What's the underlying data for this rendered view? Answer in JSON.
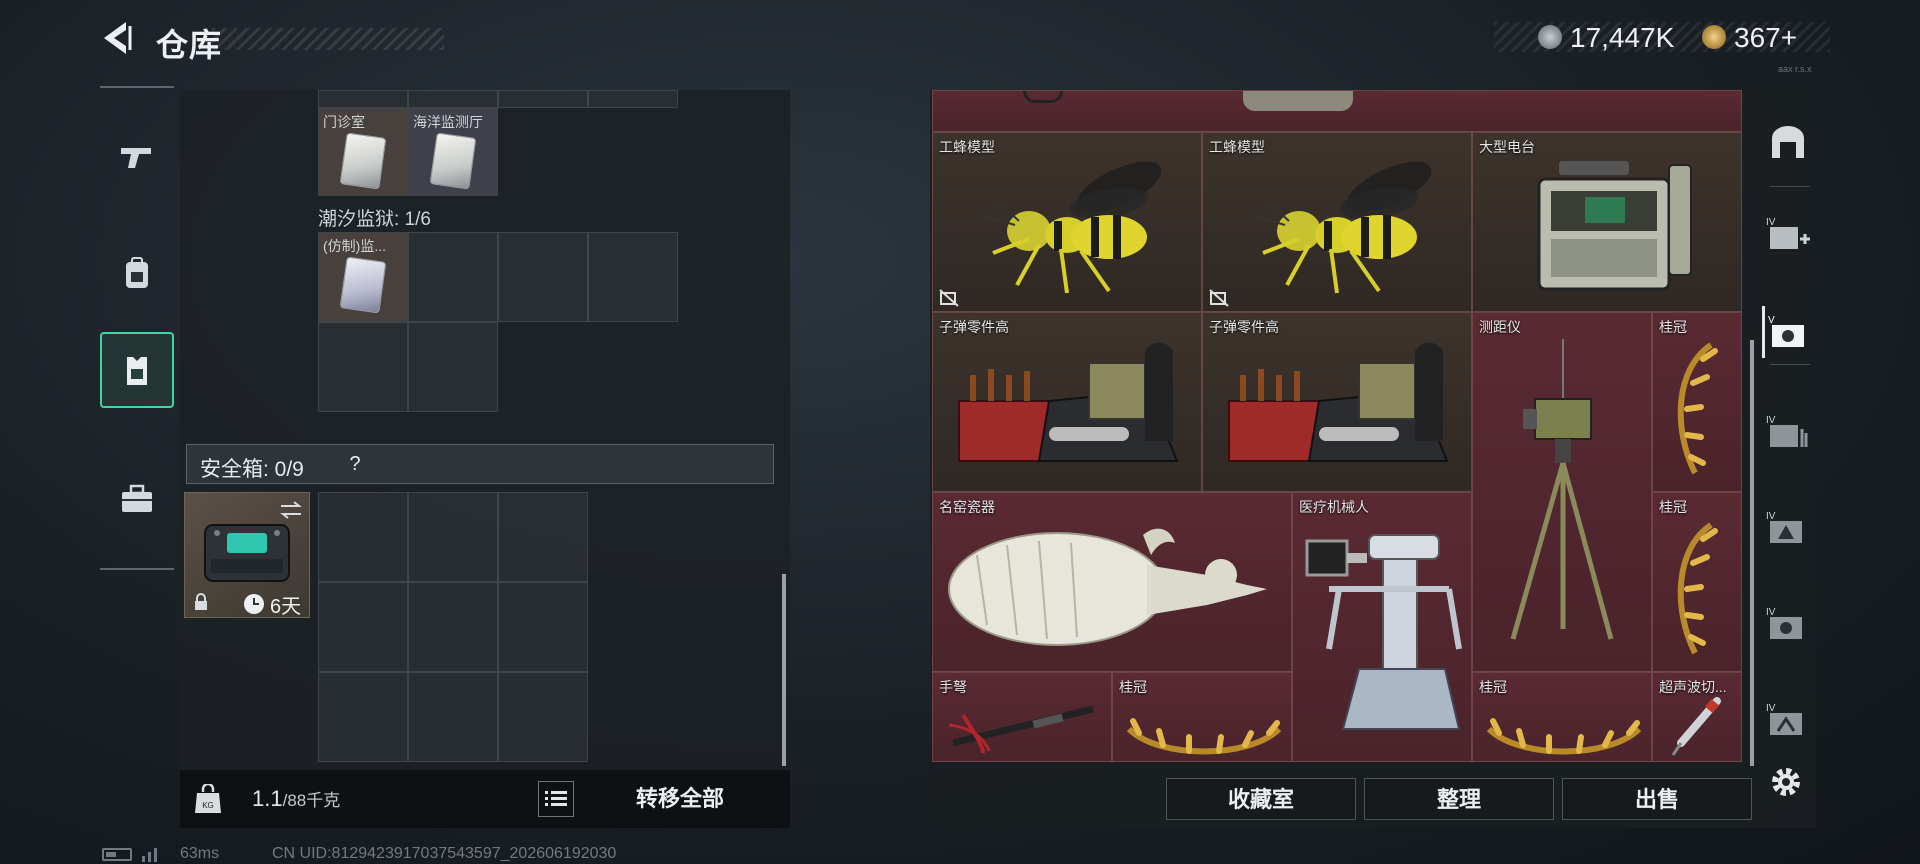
{
  "header": {
    "title": "仓库",
    "currency_silver": "17,447K",
    "currency_gold": "367+",
    "version_text": "aax r.s.x"
  },
  "left_panel": {
    "container_label": "潮汐监狱: 1/6",
    "items": [
      {
        "name": "门诊室",
        "icon": "keycard-icon"
      },
      {
        "name": "海洋监测厅",
        "icon": "keycard-icon"
      },
      {
        "name": "(仿制)监...",
        "icon": "keycard-icon"
      }
    ],
    "safe_box": {
      "label": "安全箱: 0/9",
      "help": "?",
      "timer": "6天"
    },
    "weight": {
      "current": "1.1",
      "max": "/88千克"
    },
    "transfer_all": "转移全部"
  },
  "status_bar": {
    "ping": "63ms",
    "uid": "CN UID:8129423917037543597_202606192030"
  },
  "right_panel": {
    "items": [
      {
        "name": "工蜂模型",
        "icon": "wasp-model-icon",
        "color": "dim",
        "no_insure": true
      },
      {
        "name": "工蜂模型",
        "icon": "wasp-model-icon",
        "color": "dim",
        "no_insure": true
      },
      {
        "name": "大型电台",
        "icon": "radio-station-icon",
        "color": "dim",
        "no_insure": false
      },
      {
        "name": "子弹零件高",
        "icon": "ammo-parts-icon",
        "color": "dim",
        "no_insure": false
      },
      {
        "name": "子弹零件高",
        "icon": "ammo-parts-icon",
        "color": "dim",
        "no_insure": false
      },
      {
        "name": "测距仪",
        "icon": "rangefinder-icon",
        "color": "red",
        "no_insure": false
      },
      {
        "name": "桂冠",
        "icon": "laurel-icon",
        "color": "red",
        "no_insure": false
      },
      {
        "name": "名窑瓷器",
        "icon": "porcelain-icon",
        "color": "red",
        "no_insure": false
      },
      {
        "name": "医疗机械人",
        "icon": "medical-robot-icon",
        "color": "red",
        "no_insure": false
      },
      {
        "name": "桂冠",
        "icon": "laurel-icon",
        "color": "red",
        "no_insure": false
      },
      {
        "name": "手弩",
        "icon": "crossbow-icon",
        "color": "red",
        "no_insure": false
      },
      {
        "name": "桂冠",
        "icon": "laurel-icon",
        "color": "red",
        "no_insure": false
      },
      {
        "name": "桂冠",
        "icon": "laurel-icon",
        "color": "red",
        "no_insure": false
      },
      {
        "name": "超声波切...",
        "icon": "ultrasonic-cutter-icon",
        "color": "red",
        "no_insure": false
      }
    ],
    "actions": {
      "collection": "收藏室",
      "sort": "整理",
      "sell": "出售"
    },
    "tabs": [
      {
        "icon": "all-items-icon",
        "active": false
      },
      {
        "icon": "tier-4-add-icon",
        "active": false
      },
      {
        "icon": "tier-5-valuables-icon",
        "active": true
      },
      {
        "icon": "tier-4-ammo-icon",
        "active": false
      },
      {
        "icon": "tier-4-armor-icon",
        "active": false
      },
      {
        "icon": "tier-4-gear-icon",
        "active": false
      },
      {
        "icon": "tier-4-misc-icon",
        "active": false
      }
    ]
  },
  "left_tabs": [
    {
      "icon": "gun-icon",
      "active": false
    },
    {
      "icon": "backpack-icon",
      "active": false
    },
    {
      "icon": "vest-icon",
      "active": true
    },
    {
      "icon": "toolbox-icon",
      "active": false
    }
  ],
  "colors": {
    "accent_green": "#3fd5a3",
    "red_item_bg": "#5a2a33",
    "dim_item_bg": "#3d332c"
  }
}
